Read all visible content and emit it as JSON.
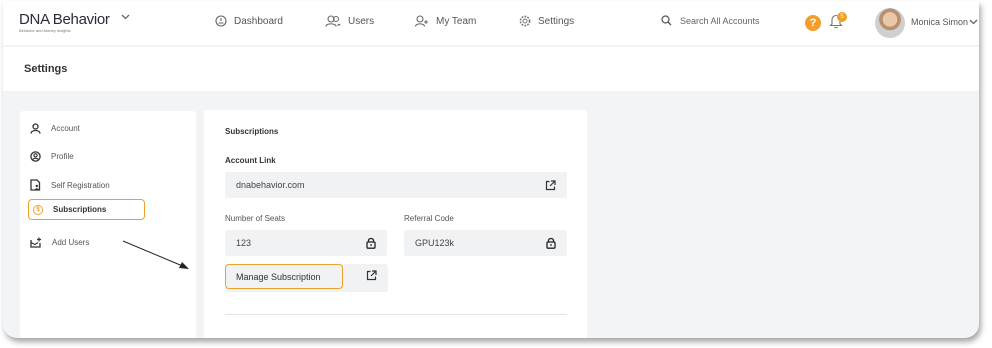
{
  "brand": {
    "logo_text": "DNA Behavior",
    "tagline": "Behavior and Money Insights"
  },
  "nav": {
    "items": [
      {
        "label": "Dashboard",
        "icon": "dashboard-icon"
      },
      {
        "label": "Users",
        "icon": "users-icon"
      },
      {
        "label": "My Team",
        "icon": "my-team-icon"
      },
      {
        "label": "Settings",
        "icon": "gear-icon"
      }
    ]
  },
  "search": {
    "label": "Search All Accounts"
  },
  "help": {
    "glyph": "?"
  },
  "notifications": {
    "count": "5"
  },
  "user": {
    "name": "Monica Simon"
  },
  "page": {
    "title": "Settings"
  },
  "sidebar": {
    "items": [
      {
        "label": "Account",
        "icon": "person-icon"
      },
      {
        "label": "Profile",
        "icon": "profile-circle-icon"
      },
      {
        "label": "Self Registration",
        "icon": "document-user-icon"
      },
      {
        "label": "Subscriptions",
        "icon": "coin-icon",
        "active": true
      },
      {
        "label": "Add Users",
        "icon": "add-users-icon"
      }
    ]
  },
  "subscriptions": {
    "title": "Subscriptions",
    "account_link_label": "Account Link",
    "account_link_value": "dnabehavior.com",
    "seats_label": "Number of Seats",
    "seats_value": "123",
    "referral_label": "Referral Code",
    "referral_value": "GPU123k",
    "manage_button": "Manage Subscription"
  },
  "colors": {
    "accent": "#f0a02a",
    "page_bg": "#f3f4f6",
    "field_bg": "#f1f2f4"
  }
}
